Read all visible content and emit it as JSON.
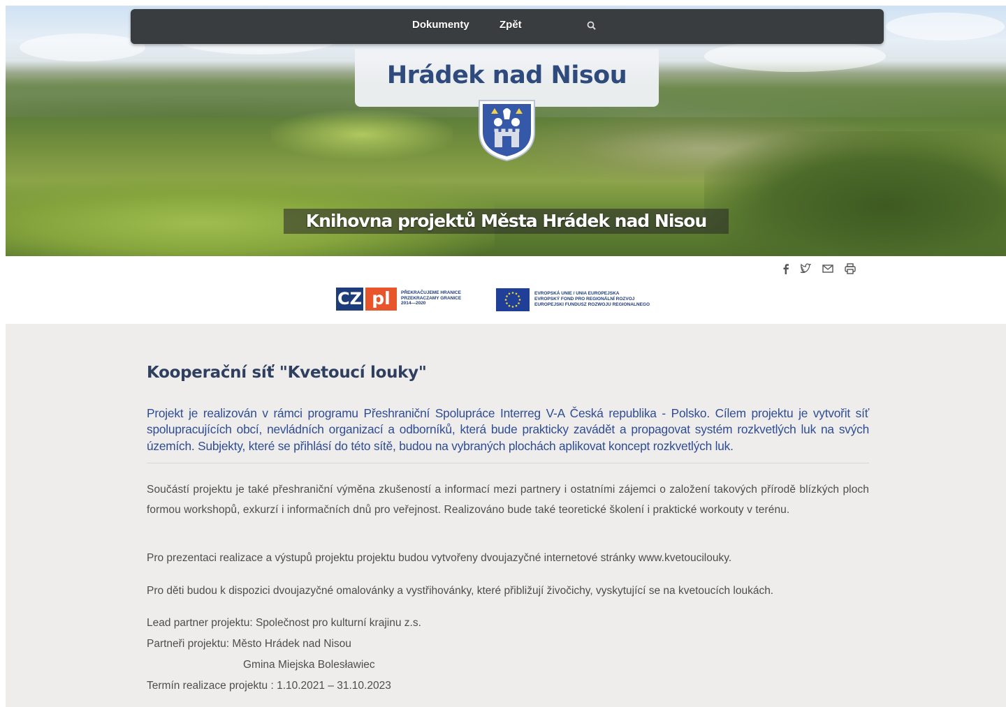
{
  "nav": {
    "documents_label": "Dokumenty",
    "back_label": "Zpět",
    "search_icon": "search-icon"
  },
  "header": {
    "site_title": "Hrádek nad Nisou",
    "subtitle": "Knihovna projektů Města Hrádek nad Nisou",
    "coat_of_arms": "coat-of-arms-icon"
  },
  "share": {
    "icons": [
      "facebook-icon",
      "twitter-icon",
      "mail-icon",
      "print-icon"
    ]
  },
  "logos": {
    "czpl": {
      "cz": "CZ",
      "pl": "pl",
      "text": "PŘEKRAČUJEME HRANICE\nPRZEKRACZAMY GRANICE\n2014—2020"
    },
    "eu": {
      "text": "EVROPSKÁ UNIE / UNIA EUROPEJSKA\nEVROPSKÝ FOND PRO REGIONÁLNÍ ROZVOJ\nEUROPEJSKI FUNDUSZ ROZWOJU REGIONALNEGO"
    }
  },
  "article": {
    "title": "Kooperační síť \"Kvetoucí louky\"",
    "lead": "Projekt je realizován v rámci programu Přeshraniční Spolupráce Interreg V-A Česká republika - Polsko. Cílem projektu je vytvořit síť spolupracujících obcí, nevládních organizací a odborníků, která bude prakticky zavádět a propagovat systém rozkvetlých luk na svých územích. Subjekty, které se přihlásí do této sítě, budou na vybraných plochách aplikovat koncept rozkvetlých luk.",
    "p1": "Součástí projektu je také přeshraniční výměna zkušeností a informací mezi partnery i ostatními zájemci o založení takových přírodě blízkých ploch formou workshopů, exkurzí i informačních dnů pro veřejnost. Realizováno bude také teoretické školení i praktické workouty v terénu.",
    "p2": "Pro prezentaci realizace a výstupů projektu projektu budou vytvořeny dvoujazyčné internetové stránky www.kvetoucilouky.",
    "p3": "Pro děti budou k dispozici dvoujazyčné omalovánky a vystřihovánky, které přibližují živočichy, vyskytující se na kvetoucích loukách.",
    "lead_partner": "Lead partner projektu: Společnost pro kulturní krajinu z.s.",
    "partners": "Partneři projektu: Město Hrádek nad Nisou",
    "partner2": "Gmina Miejska Bolesławiec",
    "term": "Termín realizace projektu : 1.10.2021 – 31.10.2023"
  },
  "colors": {
    "navbar": "#3a3d3f",
    "title": "#2f4a7c",
    "lead_text": "#2e4c93",
    "body_text": "#4d4d4d",
    "content_bg": "#efedec"
  }
}
